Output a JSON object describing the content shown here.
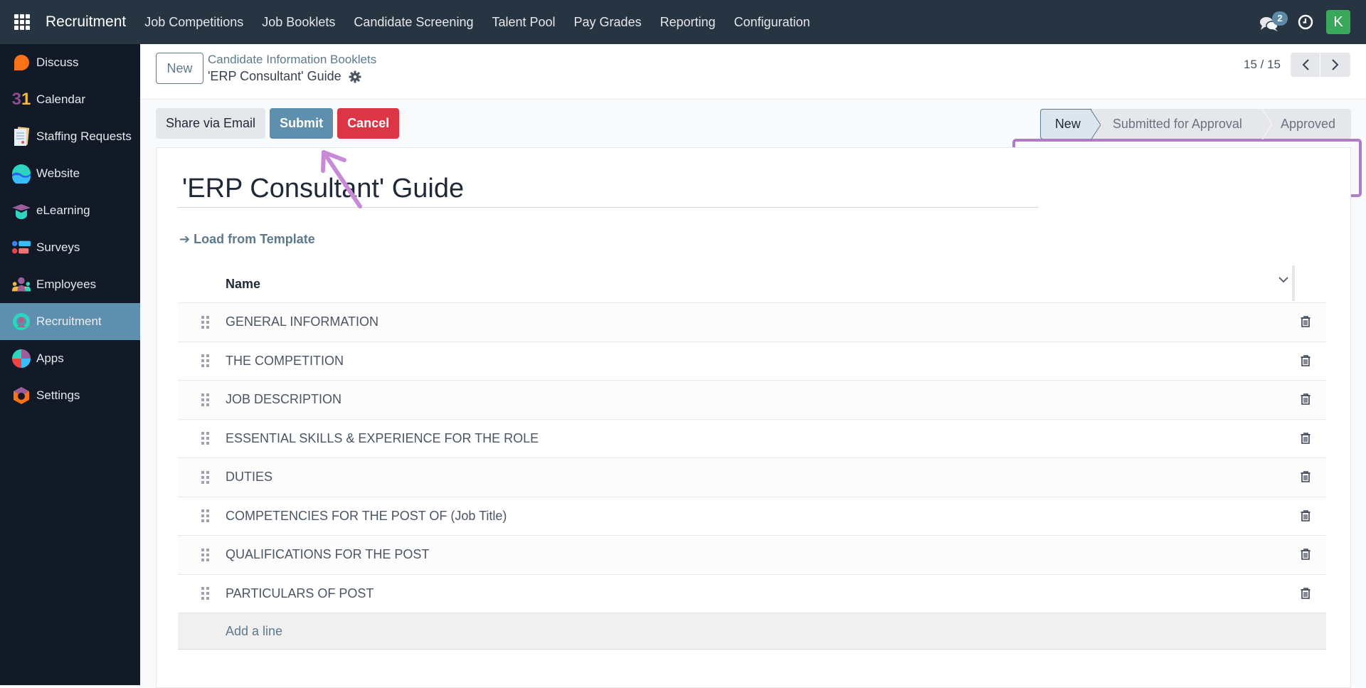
{
  "topbar": {
    "app_name": "Recruitment",
    "menu": [
      "Job Competitions",
      "Job Booklets",
      "Candidate Screening",
      "Talent Pool",
      "Pay Grades",
      "Reporting",
      "Configuration"
    ],
    "messages_badge": "2",
    "avatar_initial": "K",
    "icons": {
      "apps": "grid-icon",
      "messages": "chat-icon",
      "activities": "clock-icon"
    }
  },
  "sidebar": {
    "items": [
      {
        "label": "Discuss",
        "icon": "discuss-icon"
      },
      {
        "label": "Calendar",
        "icon": "calendar-icon",
        "icon_text": "31"
      },
      {
        "label": "Staffing Requests",
        "icon": "document-icon"
      },
      {
        "label": "Website",
        "icon": "website-icon"
      },
      {
        "label": "eLearning",
        "icon": "graduation-cap-icon"
      },
      {
        "label": "Surveys",
        "icon": "surveys-icon"
      },
      {
        "label": "Employees",
        "icon": "employees-icon"
      },
      {
        "label": "Recruitment",
        "icon": "recruitment-icon",
        "active": true
      },
      {
        "label": "Apps",
        "icon": "apps-icon"
      },
      {
        "label": "Settings",
        "icon": "settings-icon"
      }
    ]
  },
  "control_panel": {
    "new_label": "New",
    "breadcrumb_parent": "Candidate Information Booklets",
    "breadcrumb_current": "'ERP Consultant' Guide",
    "pager": "15 / 15"
  },
  "actions": {
    "share": "Share via Email",
    "submit": "Submit",
    "cancel": "Cancel"
  },
  "status": {
    "stages": [
      "New",
      "Submitted for Approval",
      "Approved"
    ],
    "current": "New"
  },
  "form": {
    "title": "'ERP Consultant' Guide",
    "load_template": "Load from Template",
    "load_template_arrow": "➔",
    "table": {
      "header": "Name",
      "rows": [
        "GENERAL INFORMATION",
        "THE COMPETITION",
        "JOB DESCRIPTION",
        "ESSENTIAL SKILLS & EXPERIENCE FOR THE ROLE",
        "DUTIES",
        "COMPETENCIES FOR THE POST OF (Job Title)",
        "QUALIFICATIONS FOR THE POST",
        "PARTICULARS OF POST"
      ],
      "add_line": "Add a line"
    }
  },
  "colors": {
    "topbar": "#263541",
    "sidebar": "#121a28",
    "accent": "#5e8fae",
    "danger": "#dc3545",
    "annotation": "#b07cc6"
  }
}
